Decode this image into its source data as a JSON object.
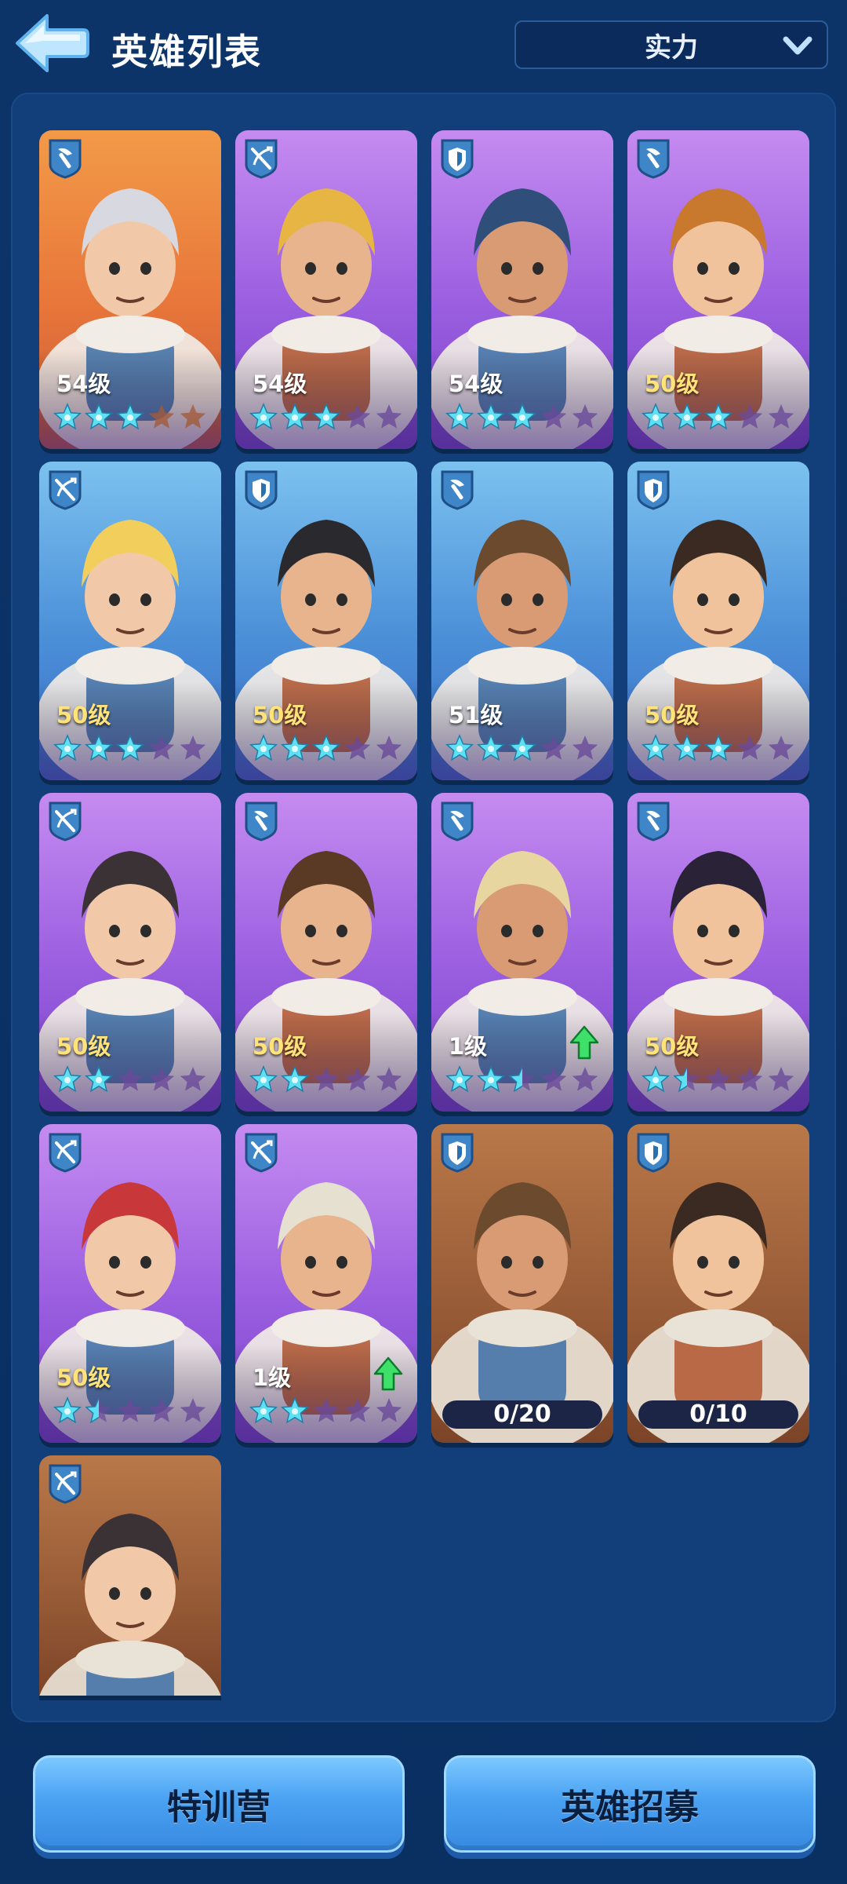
{
  "header": {
    "title": "英雄列表",
    "sort_selected": "实力"
  },
  "heroes": [
    {
      "level": "54级",
      "stars": 3,
      "max_stars": 5,
      "class_icon": "pickaxe-icon",
      "bg": "orange"
    },
    {
      "level": "54级",
      "stars": 3,
      "max_stars": 5,
      "class_icon": "crossbow-icon",
      "bg": "purple"
    },
    {
      "level": "54级",
      "stars": 3,
      "max_stars": 5,
      "class_icon": "shield-icon",
      "bg": "purple"
    },
    {
      "level": "50级",
      "stars": 3,
      "max_stars": 5,
      "class_icon": "pickaxe-icon",
      "bg": "purple"
    },
    {
      "level": "50级",
      "stars": 3,
      "max_stars": 5,
      "class_icon": "crossbow-icon",
      "bg": "blue"
    },
    {
      "level": "50级",
      "stars": 3,
      "max_stars": 5,
      "class_icon": "shield-icon",
      "bg": "blue"
    },
    {
      "level": "51级",
      "stars": 3,
      "max_stars": 5,
      "class_icon": "pickaxe-icon",
      "bg": "blue"
    },
    {
      "level": "50级",
      "stars": 3,
      "max_stars": 5,
      "class_icon": "shield-icon",
      "bg": "blue"
    },
    {
      "level": "50级",
      "stars": 2,
      "max_stars": 5,
      "class_icon": "crossbow-icon",
      "bg": "purple"
    },
    {
      "level": "50级",
      "stars": 2,
      "max_stars": 5,
      "class_icon": "pickaxe-icon",
      "bg": "purple"
    },
    {
      "level": "1级",
      "stars": 2.5,
      "max_stars": 5,
      "class_icon": "pickaxe-icon",
      "bg": "purple",
      "upgrade": true
    },
    {
      "level": "50级",
      "stars": 1.5,
      "max_stars": 5,
      "class_icon": "pickaxe-icon",
      "bg": "purple"
    },
    {
      "level": "50级",
      "stars": 1.5,
      "max_stars": 5,
      "class_icon": "crossbow-icon",
      "bg": "purple"
    },
    {
      "level": "1级",
      "stars": 2,
      "max_stars": 5,
      "class_icon": "crossbow-icon",
      "bg": "purple",
      "upgrade": true
    }
  ],
  "locked_heroes": [
    {
      "shards": "0/20",
      "class_icon": "shield-icon",
      "bg": "bronze"
    },
    {
      "shards": "0/10",
      "class_icon": "shield-icon",
      "bg": "bronze"
    },
    {
      "class_icon": "crossbow-icon",
      "bg": "bronze"
    }
  ],
  "buttons": {
    "training": "特训营",
    "recruit": "英雄招募"
  }
}
